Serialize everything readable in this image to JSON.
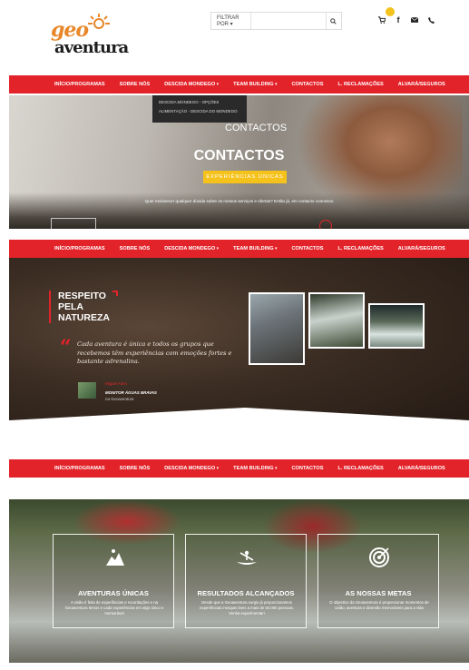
{
  "header": {
    "logo_top": "geo",
    "logo_bottom": "aventura",
    "filter_label": "FILTRAR POR ▾",
    "search_placeholder": "",
    "icons": [
      "cart-icon",
      "facebook-icon",
      "mail-icon",
      "phone-icon"
    ]
  },
  "nav": {
    "items": [
      "INÍCIO/PROGRAMAS",
      "SOBRE NÓS",
      "DESCIDA MONDEGO",
      "TEAM BUILDING",
      "CONTACTOS",
      "L. RECLAMAÇÕES",
      "ALVARÁ/SEGUROS"
    ]
  },
  "dropdown": {
    "items": [
      "DESCIDA MONDEGO - OPÇÕES",
      "ALIMENTAÇÃO - DESCIDA DO MONDEGO"
    ]
  },
  "hero": {
    "image_alt": "CONTACTOS",
    "title": "CONTACTOS",
    "tagline": "EXPERIÊNCIAS ÚNICAS",
    "subtitle": "Quer esclarecer qualquer dúvida sobre os nossos serviços e ofertas? Então já, em contacto connosco"
  },
  "respect": {
    "line1": "RESPEITO",
    "line2": "PELA",
    "line3": "NATUREZA",
    "quote": "Cada aventura é única e todos os grupos que recebemos têm experiências com emoções fortes e bastante adrenalina.",
    "author_name": "Miguel Aires",
    "author_title": "MONITOR ÁGUAS BRAVAS",
    "author_sub": "na Geoaventura"
  },
  "cards": [
    {
      "icon": "tower-climb-icon",
      "title": "AVENTURAS ÚNICAS",
      "text": "A visão é feita de experiências e recordações e na Geoaventura temos e cada experiências em algo único e memorável"
    },
    {
      "icon": "kayak-icon",
      "title": "RESULTADOS ALCANÇADOS",
      "text": "Desde que a Geoaventura surgiu já proporcionamos experiências inesquecíveis a mais de 50.000 pessoas. Venha experimentar!"
    },
    {
      "icon": "target-icon",
      "title": "AS NOSSAS METAS",
      "text": "O objectivo da Geoaventura é proporcionar momentos de união, aventura e diversão memoráveis para a vida"
    }
  ],
  "colors": {
    "brand_red": "#e3232a",
    "accent_yellow": "#f5c21b",
    "logo_orange": "#e8872a"
  }
}
